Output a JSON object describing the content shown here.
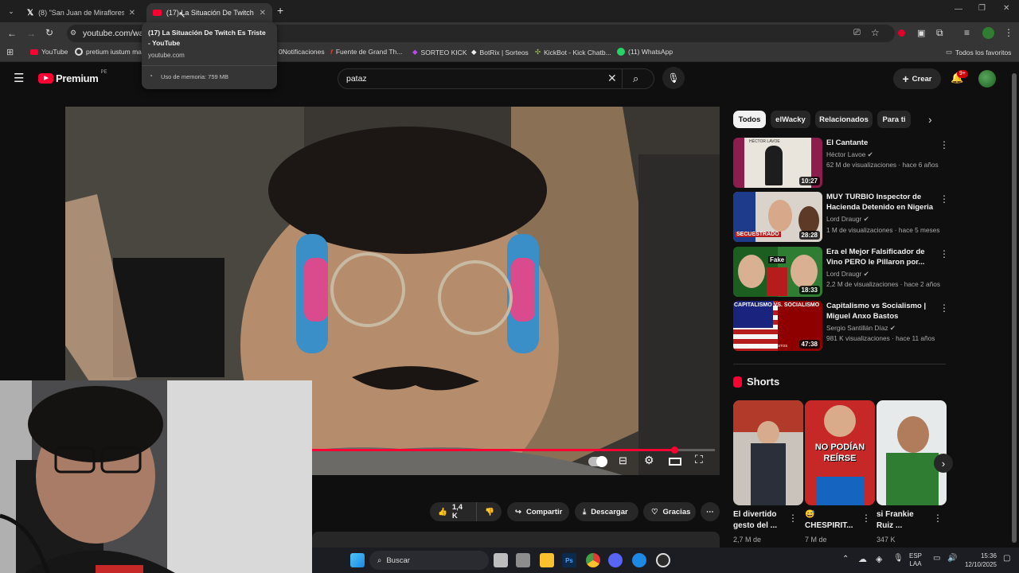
{
  "tabs": [
    {
      "title": "(8) \"San Juan de Miraflores\" - B"
    },
    {
      "title": "(17) La Situación De Twitch Es T"
    }
  ],
  "tooltip": {
    "title": "(17) La Situación De Twitch Es Triste - YouTube",
    "domain": "youtube.com",
    "memory": "Uso de memoria: 759 MB"
  },
  "address": {
    "url": "youtube.com/wat"
  },
  "bookmarks": [
    {
      "label": "YouTube"
    },
    {
      "label": "pretium iustum ma"
    },
    {
      "label": "0Notificaciones"
    },
    {
      "label": "Fuente de Grand Th..."
    },
    {
      "label": "SORTEO KICK"
    },
    {
      "label": "BotRix | Sorteos"
    },
    {
      "label": "KickBot - Kick Chatb..."
    },
    {
      "label": "(11) WhatsApp"
    }
  ],
  "bookmarks_folder": "Todos los favoritos",
  "header": {
    "logo_text": "Premium",
    "logo_region": "PE",
    "search_value": "pataz",
    "create_label": "Crear",
    "notification_badge": "9+"
  },
  "actions": {
    "likes": "1,4 K",
    "share": "Compartir",
    "download": "Descargar",
    "thanks": "Gracias"
  },
  "chips": [
    "Todos",
    "elWacky",
    "Relacionados",
    "Para ti"
  ],
  "videos": [
    {
      "title": "El Cantante",
      "channel": "Héctor Lavoe",
      "meta": "62 M de visualizaciones · hace 6 años",
      "duration": "10:27"
    },
    {
      "title": "MUY TURBIO Inspector de Hacienda Detenido en Nigeria",
      "channel": "Lord Draugr",
      "meta": "1 M de visualizaciones · hace 5 meses",
      "duration": "28:28"
    },
    {
      "title": "Era el Mejor Falsificador de Vino PERO le Pillaron por...",
      "channel": "Lord Draugr",
      "meta": "2,2 M de visualizaciones · hace 2 años",
      "duration": "18:33"
    },
    {
      "title": "Capitalismo vs Socialismo | Miguel Anxo Bastos",
      "channel": "Sergio Santillán Díaz",
      "meta": "981 K visualizaciones · hace 11 años",
      "duration": "47:38"
    }
  ],
  "thumb_texts": {
    "t1": "HÉCTOR LAVOE",
    "t2": "SECUESTRADO",
    "t3": "Fake",
    "t4a": "CAPITALISMO VS. SOCIALISMO",
    "t4b": "MIGUEL ANXO BASTOS"
  },
  "shorts_label": "Shorts",
  "shorts": [
    {
      "title1": "El divertido",
      "title2": "gesto del ...",
      "meta": "2,7 M de"
    },
    {
      "title1": "😅 ",
      "title2": "CHESPIRIT...",
      "meta": "7 M de",
      "thumb_text": "NO PODÍAN REÍRSE"
    },
    {
      "title1": "si Frankie",
      "title2": "Ruiz ...",
      "meta": "347 K"
    }
  ],
  "taskbar": {
    "search": "Buscar",
    "lang1": "ESP",
    "lang2": "LAA",
    "time": "15:36",
    "date": "12/10/2025"
  },
  "colors": {
    "accent_red": "#ff0033",
    "yt_bg": "#0f0f0f",
    "chip_bg": "#272727"
  }
}
